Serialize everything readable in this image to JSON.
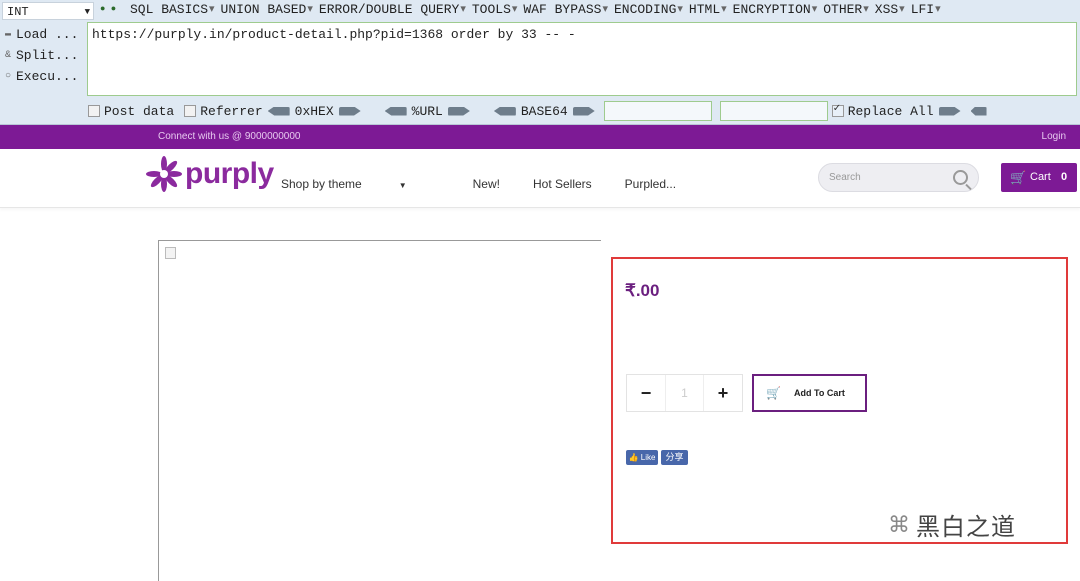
{
  "hackbar": {
    "select_value": "INT",
    "menu": [
      "SQL BASICS",
      "UNION BASED",
      "ERROR/DOUBLE QUERY",
      "TOOLS",
      "WAF BYPASS",
      "ENCODING",
      "HTML",
      "ENCRYPTION",
      "OTHER",
      "XSS",
      "LFI"
    ],
    "side": [
      "Load ...",
      "Split...",
      "Execu..."
    ],
    "url_value": "https://purply.in/product-detail.php?pid=1368 order by 33 -- -",
    "post_data": "Post data",
    "referrer": "Referrer",
    "hex": "0xHEX",
    "url_enc": "%URL",
    "base64": "BASE64",
    "replace_all": "Replace All"
  },
  "site": {
    "contact": "Connect with us @ 9000000000",
    "login": "Login",
    "logo_text": "purply",
    "menu": [
      "Shop by theme",
      "New!",
      "Hot Sellers",
      "Purpled..."
    ],
    "search_placeholder": "Search",
    "cart_label": "Cart",
    "cart_count": "0",
    "price": "₹.00",
    "qty_minus": "−",
    "qty_value": "1",
    "qty_plus": "+",
    "add_to_cart": "Add To Cart",
    "like_label": "👍 Like",
    "share_label": "分享"
  },
  "watermark": "黑白之道",
  "colors": {
    "brand": "#7d1a95",
    "highlight_border": "#e03a3a",
    "hackbar_bg": "#dfe9f3"
  }
}
